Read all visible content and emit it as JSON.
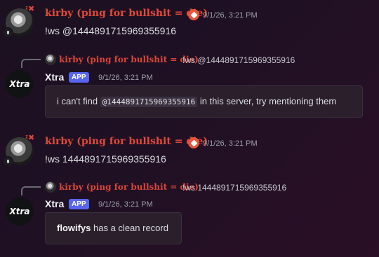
{
  "messages": [
    {
      "author": "kirby (ping for bullshit = die)",
      "timestamp": "9/1/26, 3:21 PM",
      "text": "!ws @1444891715969355916"
    },
    {
      "reply": {
        "author": "kirby (ping for bullshit = die)",
        "text": "!ws @1444891715969355916"
      },
      "author": "Xtra",
      "tag": "APP",
      "timestamp": "9/1/26, 3:21 PM",
      "embed": {
        "prefix": "i can't find ",
        "code": "@1444891715969355916",
        "suffix": " in this server, try mentioning them"
      }
    },
    {
      "author": "kirby (ping for bullshit = die)",
      "timestamp": "9/1/26, 3:21 PM",
      "text": "!ws 1444891715969355916"
    },
    {
      "reply": {
        "author": "kirby (ping for bullshit = die)",
        "text": "!ws 1444891715969355916"
      },
      "author": "Xtra",
      "tag": "APP",
      "timestamp": "9/1/26, 3:21 PM",
      "embed": {
        "bold": "flowifys",
        "rest": " has a clean record"
      }
    }
  ],
  "avatar_labels": {
    "xtra": "Xtra"
  },
  "colors": {
    "kirby_name": "#e04a3a",
    "app_tag": "#5865f2",
    "background": "#1f1024"
  }
}
